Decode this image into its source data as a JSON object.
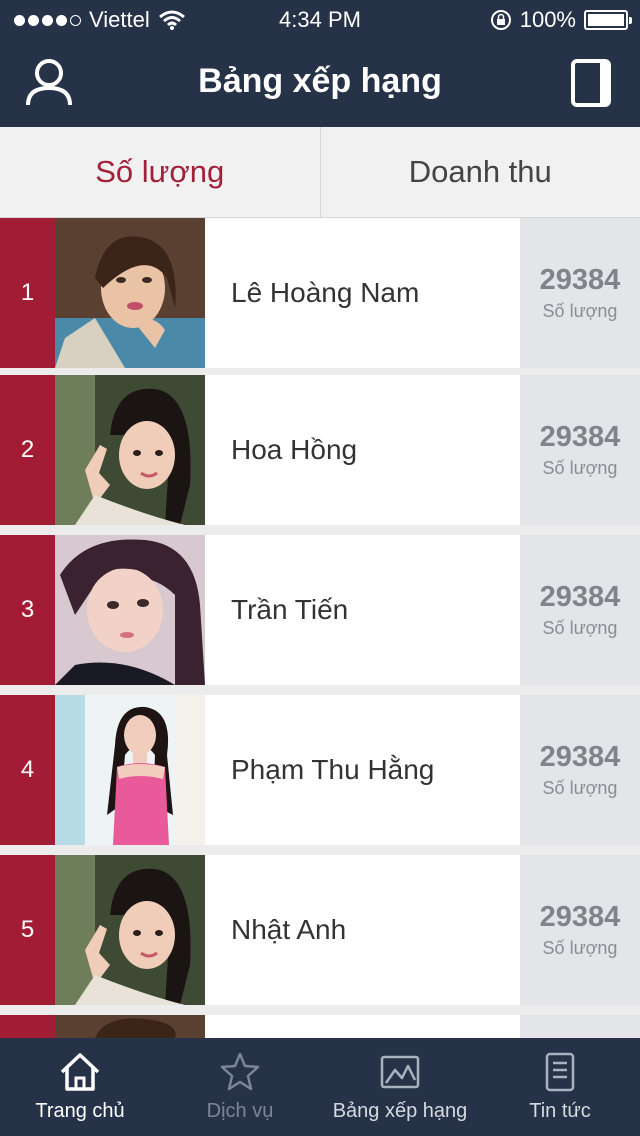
{
  "status_bar": {
    "carrier": "Viettel",
    "time": "4:34 PM",
    "battery": "100%"
  },
  "header": {
    "title": "Bảng xếp hạng"
  },
  "tabs": [
    {
      "label": "Số lượng",
      "active": true
    },
    {
      "label": "Doanh thu",
      "active": false
    }
  ],
  "rankings": [
    {
      "rank": "1",
      "name": "Lê Hoàng Nam",
      "value": "29384",
      "unit": "Số lượng"
    },
    {
      "rank": "2",
      "name": "Hoa Hồng",
      "value": "29384",
      "unit": "Số lượng"
    },
    {
      "rank": "3",
      "name": "Trần Tiến",
      "value": "29384",
      "unit": "Số lượng"
    },
    {
      "rank": "4",
      "name": "Phạm Thu Hằng",
      "value": "29384",
      "unit": "Số lượng"
    },
    {
      "rank": "5",
      "name": "Nhật Anh",
      "value": "29384",
      "unit": "Số lượng"
    }
  ],
  "tabbar": [
    {
      "label": "Trang chủ",
      "icon": "home-icon",
      "active": true
    },
    {
      "label": "Dịch vụ",
      "icon": "star-icon",
      "active": false
    },
    {
      "label": "Bảng xếp hạng",
      "icon": "chart-icon",
      "active": false
    },
    {
      "label": "Tin tức",
      "icon": "news-icon",
      "active": false
    }
  ],
  "colors": {
    "header_bg": "#263247",
    "accent": "#a31c35",
    "active_tab_text": "#a3203a"
  }
}
